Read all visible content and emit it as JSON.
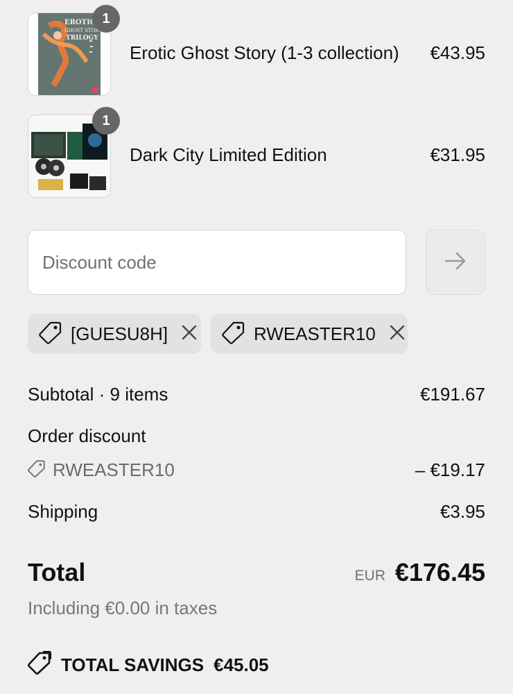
{
  "line_items": [
    {
      "name": "Erotic Ghost Story (1-3 collection)",
      "price": "€43.95",
      "quantity": "1",
      "cover_text": [
        "EROTIC",
        "GHOST STORY",
        "TRILOGY"
      ]
    },
    {
      "name": "Dark City Limited Edition",
      "price": "€31.95",
      "quantity": "1"
    }
  ],
  "discount": {
    "placeholder": "Discount code",
    "value": "",
    "applied_codes": [
      "[GUESU8H]",
      "RWEASTER10"
    ]
  },
  "summary": {
    "subtotal_label": "Subtotal · 9 items",
    "subtotal_value": "€191.67",
    "order_discount_label": "Order discount",
    "order_discount_code": "RWEASTER10",
    "order_discount_value": "– €19.17",
    "shipping_label": "Shipping",
    "shipping_value": "€3.95"
  },
  "total": {
    "label": "Total",
    "currency": "EUR",
    "amount": "€176.45",
    "tax_note": "Including €0.00 in taxes"
  },
  "savings": {
    "label": "TOTAL SAVINGS",
    "amount": "€45.05"
  },
  "colors": {
    "background": "#efefef",
    "badge": "#666666",
    "chip": "#e2e2e2",
    "muted_text": "#6b6b6b"
  }
}
